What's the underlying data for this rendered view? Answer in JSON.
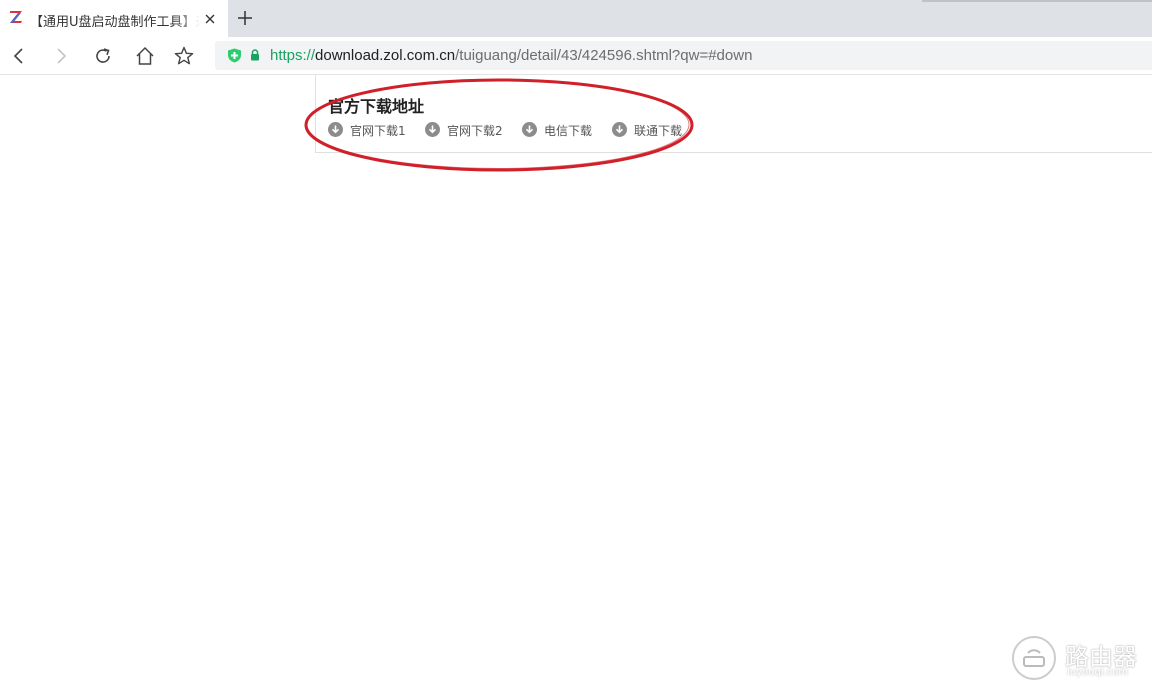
{
  "browser": {
    "tab": {
      "title": "【通用U盘启动盘制作工具】通用",
      "favicon": "zol-z-logo-icon"
    },
    "new_tab_icon": "plus-icon",
    "toolbar": {
      "back_icon": "back-arrow-icon",
      "forward_icon": "forward-arrow-icon",
      "reload_icon": "reload-icon",
      "home_icon": "home-icon",
      "bookmark_icon": "star-icon"
    },
    "omnibox": {
      "security_icons": [
        "shield-plus-icon",
        "lock-icon"
      ],
      "url_scheme": "https://",
      "url_host": "download.zol.com.cn",
      "url_path": "/tuiguang/detail/43/424596.shtml?qw=#down"
    }
  },
  "page": {
    "section_title": "官方下载地址",
    "download_links": [
      {
        "label": "官网下载1",
        "icon": "download-arrow-icon"
      },
      {
        "label": "官网下载2",
        "icon": "download-arrow-icon"
      },
      {
        "label": "电信下载",
        "icon": "download-arrow-icon"
      },
      {
        "label": "联通下载",
        "icon": "download-arrow-icon"
      }
    ],
    "annotation": {
      "shape": "red-ellipse",
      "color": "#d0202a"
    }
  },
  "watermark": {
    "text": "路由器",
    "subtext": "luyouqi.com"
  },
  "colors": {
    "tabstrip": "#dee1e6",
    "url_scheme": "#1aa260",
    "shield_green": "#2ecc71",
    "icon_gray": "#8c8c8c"
  }
}
